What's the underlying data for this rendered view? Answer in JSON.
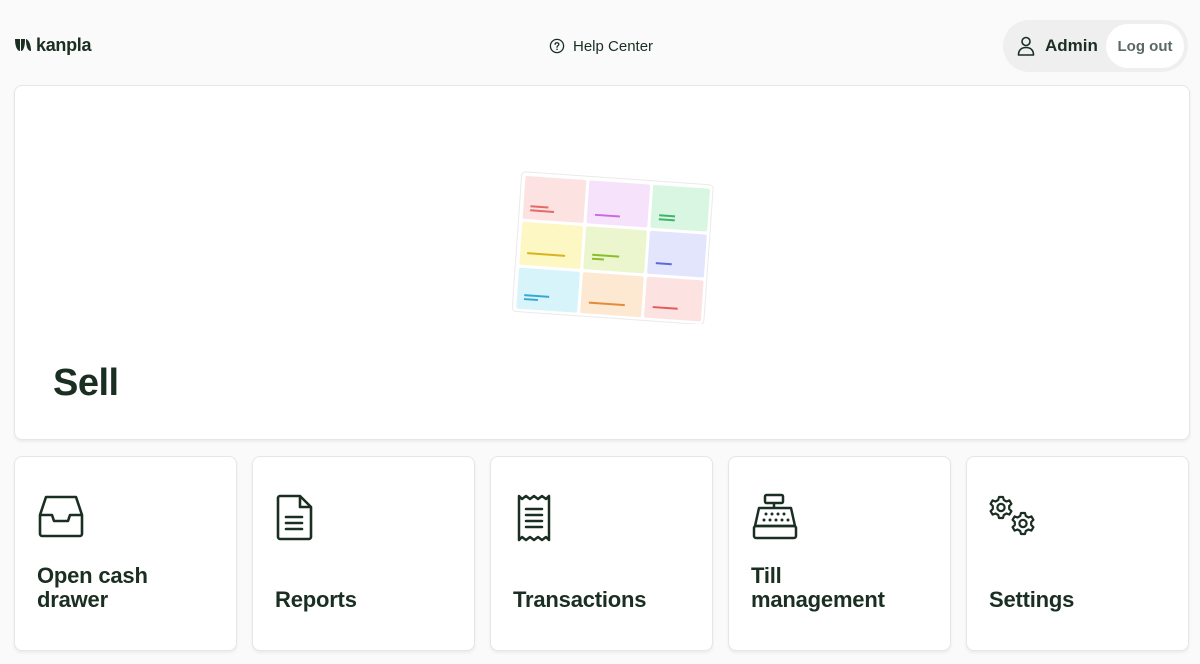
{
  "header": {
    "logo_text": "kanpla",
    "help_label": "Help Center",
    "user_name": "Admin",
    "logout_label": "Log out"
  },
  "sell": {
    "title": "Sell"
  },
  "tiles": [
    {
      "label": "Open cash\ndrawer",
      "icon": "cash-drawer-icon"
    },
    {
      "label": "Reports",
      "icon": "document-icon"
    },
    {
      "label": "Transactions",
      "icon": "receipt-icon"
    },
    {
      "label": "Till\nmanagement",
      "icon": "cash-register-icon"
    },
    {
      "label": "Settings",
      "icon": "gears-icon"
    }
  ],
  "colors": {
    "text": "#1a2e22",
    "background": "#fafafa",
    "card": "#ffffff",
    "pill": "#efefef"
  }
}
